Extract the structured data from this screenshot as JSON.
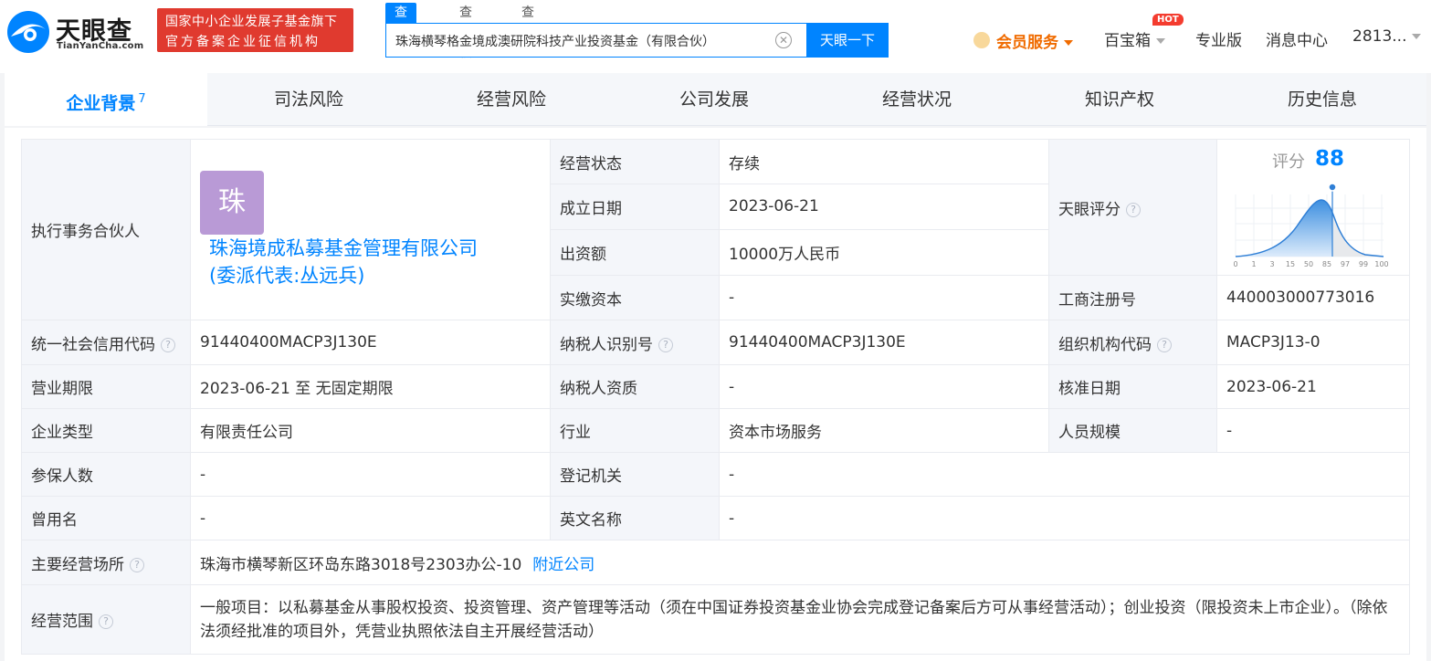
{
  "header": {
    "logo_title": "天眼查",
    "logo_sub": "TianYanCha.com",
    "badge_line1": "国家中小企业发展子基金旗下",
    "badge_line2": "官方备案企业征信机构",
    "search_tabs": [
      "查公司",
      "查老板",
      "查关系"
    ],
    "search_value": "珠海横琴格金境成澳研院科技产业投资基金（有限合伙）",
    "search_button": "天眼一下",
    "vip_label": "会员服务",
    "hot_badge": "HOT",
    "treasure_label": "百宝箱",
    "pro_label": "专业版",
    "message_label": "消息中心",
    "user_label": "2813..."
  },
  "tabs": [
    {
      "label": "企业背景",
      "count": "7"
    },
    {
      "label": "司法风险"
    },
    {
      "label": "经营风险"
    },
    {
      "label": "公司发展"
    },
    {
      "label": "经营状况"
    },
    {
      "label": "知识产权"
    },
    {
      "label": "历史信息"
    }
  ],
  "info": {
    "partner_key": "执行事务合伙人",
    "partner_avatar": "珠",
    "partner_name": "珠海境成私募基金管理有限公司(委派代表:丛远兵)",
    "status_key": "经营状态",
    "status_val": "存续",
    "founded_key": "成立日期",
    "founded_val": "2023-06-21",
    "capital_key": "出资额",
    "capital_val": "10000万人民币",
    "paid_key": "实缴资本",
    "paid_val": "-",
    "score_key": "天眼评分",
    "score_label": "评分",
    "score_val": "88",
    "score_ticks": [
      "0",
      "1",
      "3",
      "15",
      "50",
      "85",
      "97",
      "99",
      "100"
    ],
    "reg_no_key": "工商注册号",
    "reg_no_val": "440003000773016",
    "credit_key": "统一社会信用代码",
    "credit_val": "91440400MACP3J130E",
    "tax_key": "纳税人识别号",
    "tax_val": "91440400MACP3J130E",
    "org_key": "组织机构代码",
    "org_val": "MACP3J13-0",
    "period_key": "营业期限",
    "period_val": "2023-06-21 至 无固定期限",
    "taxpayer_key": "纳税人资质",
    "taxpayer_val": "-",
    "approve_key": "核准日期",
    "approve_val": "2023-06-21",
    "type_key": "企业类型",
    "type_val": "有限责任公司",
    "industry_key": "行业",
    "industry_val": "资本市场服务",
    "staff_key": "人员规模",
    "staff_val": "-",
    "insured_key": "参保人数",
    "insured_val": "-",
    "registry_key": "登记机关",
    "registry_val": "-",
    "former_key": "曾用名",
    "former_val": "-",
    "english_key": "英文名称",
    "english_val": "-",
    "address_key": "主要经营场所",
    "address_val": "珠海市横琴新区环岛东路3018号2303办公-10",
    "nearby_link": "附近公司",
    "scope_key": "经营范围",
    "scope_val": "一般项目：以私募基金从事股权投资、投资管理、资产管理等活动（须在中国证券投资基金业协会完成登记备案后方可从事经营活动）；创业投资（限投资未上市企业）。（除依法须经批准的项目外，凭营业执照依法自主开展经营活动）"
  },
  "colors": {
    "brand": "#0084ff",
    "red": "#e03a2f",
    "vip": "#f06b00"
  }
}
